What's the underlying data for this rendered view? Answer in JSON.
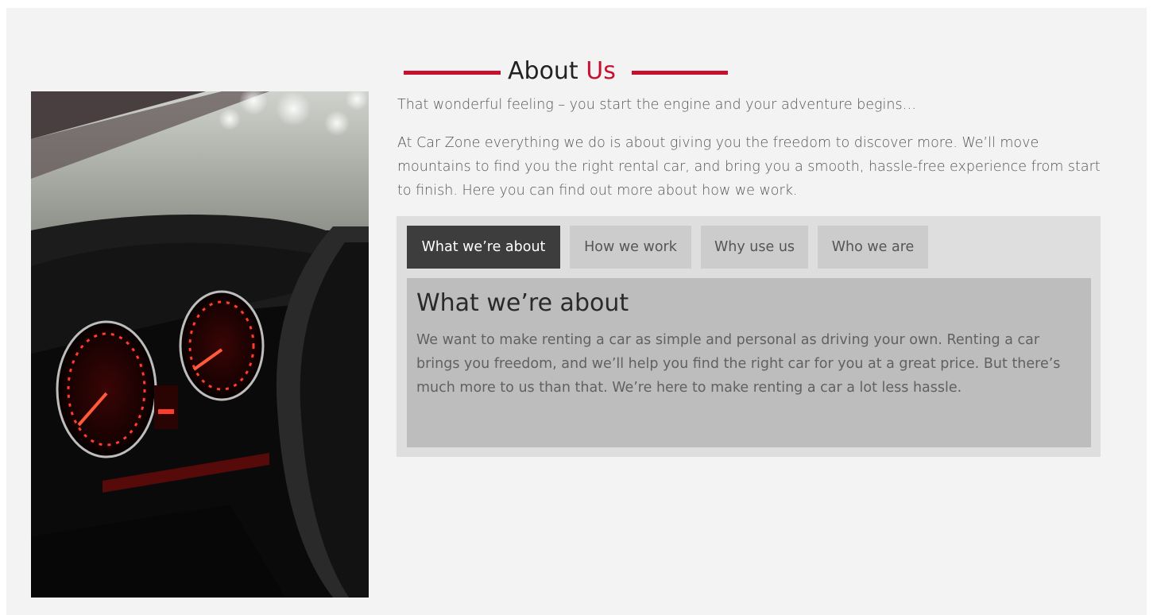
{
  "heading": {
    "title_main": "About ",
    "title_accent": "Us"
  },
  "photo": {
    "icon": "car-dashboard-image"
  },
  "intro": {
    "line1": "That wonderful feeling – you start the engine and your adventure begins…",
    "paragraph": "At Car Zone everything we do is about giving you the freedom to discover more. We’ll move mountains to find you the right rental car, and bring you a smooth, hassle-free experience from start to finish. Here you can find out more about how we work."
  },
  "tabs": [
    {
      "label": "What we’re about",
      "active": true
    },
    {
      "label": "How we work",
      "active": false
    },
    {
      "label": "Why use us",
      "active": false
    },
    {
      "label": "Who we are",
      "active": false
    }
  ],
  "panel": {
    "title": "What we’re about",
    "text": "We want to make renting a car as simple and personal as driving your own. Renting a car brings you freedom, and we’ll help you find the right car for you at a great price. But there’s much more to us than that. We’re here to make renting a car a lot less hassle."
  },
  "colors": {
    "accent": "#c8102e",
    "active_tab": "#3d3d3d",
    "tab": "#cccccc",
    "panel": "#bdbdbd",
    "background": "#f3f3f3"
  }
}
